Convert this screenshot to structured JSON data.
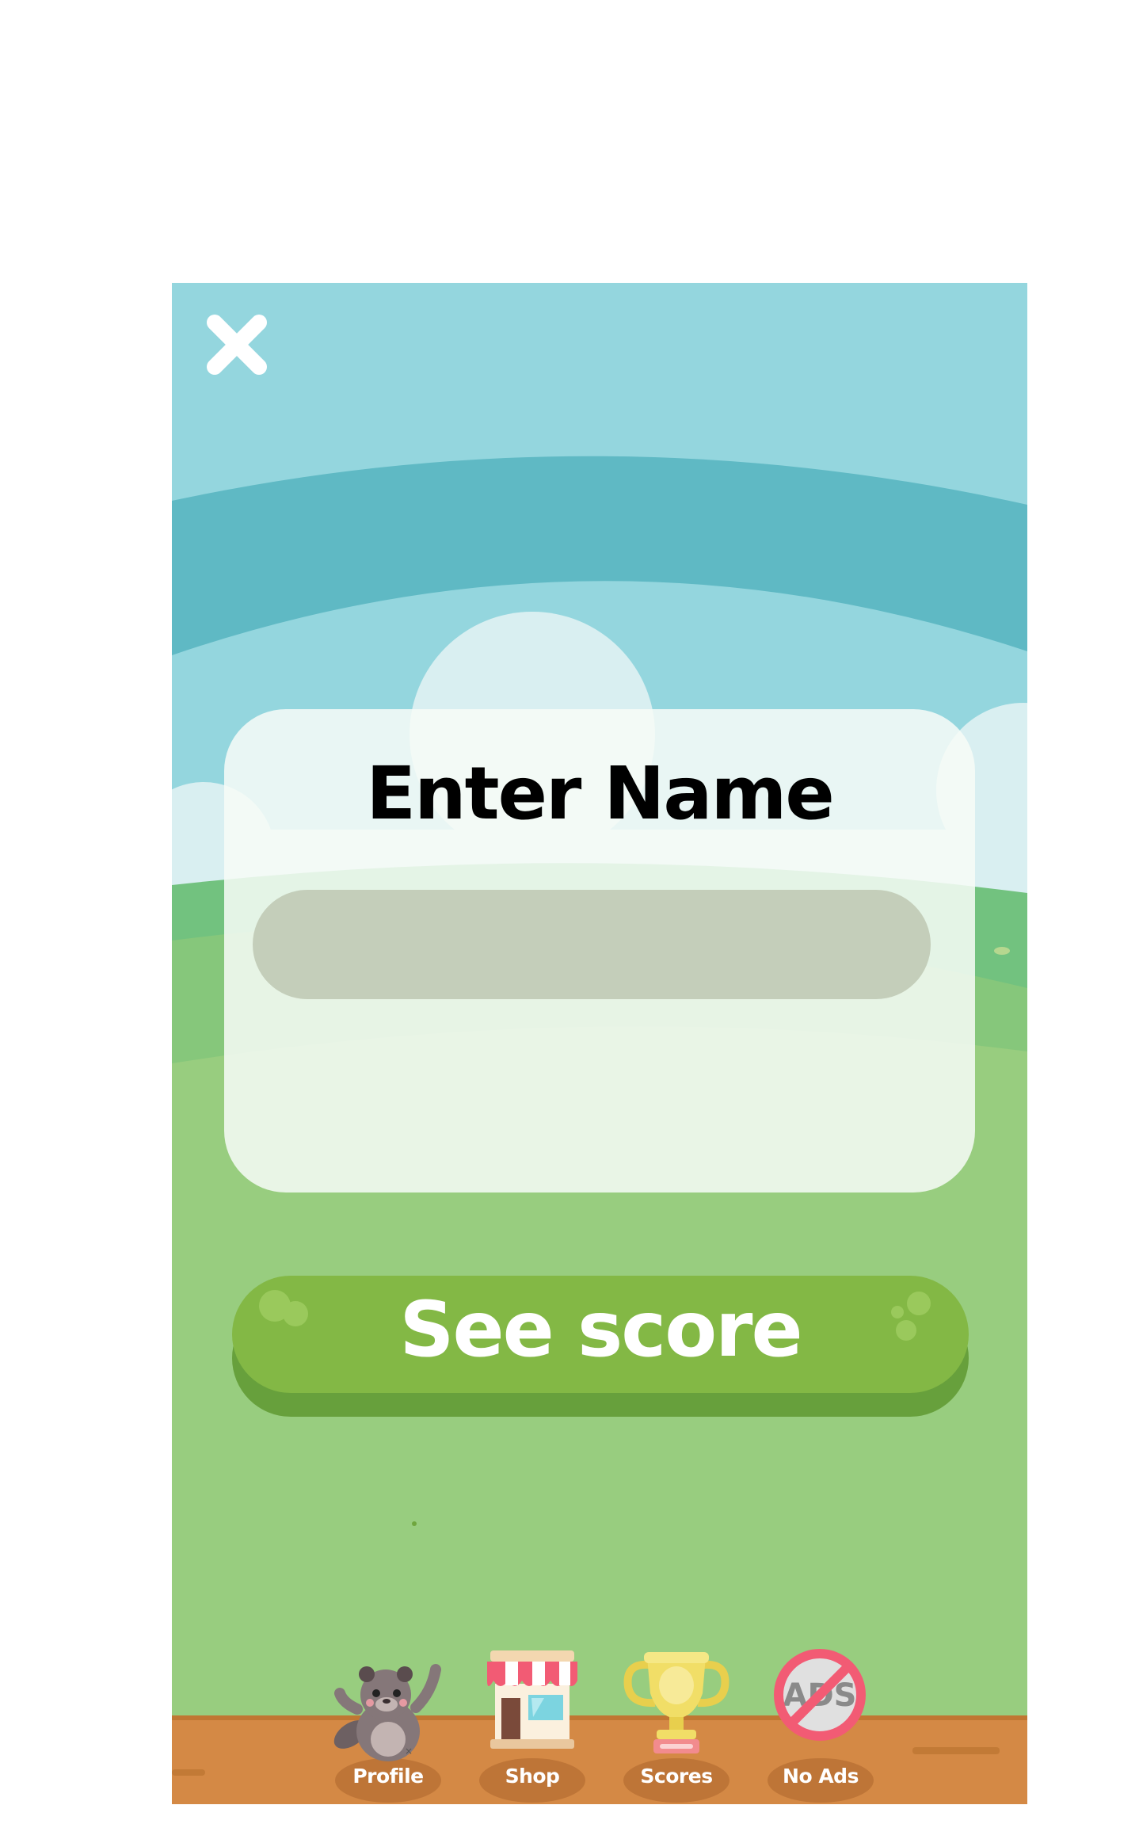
{
  "colors": {
    "sky": "#94d6de",
    "sky_band": "#5fb9c4",
    "grass": "#98cd7f",
    "dirt": "#d48945",
    "button_green": "#83b845",
    "input_fill": "#c4ceba"
  },
  "close_button": {
    "icon": "close-icon"
  },
  "name_panel": {
    "title": "Enter Name",
    "input_value": "",
    "input_placeholder": ""
  },
  "see_score_button": {
    "label": "See score"
  },
  "bottom_nav": {
    "items": [
      {
        "label": "Profile",
        "icon": "beaver-icon"
      },
      {
        "label": "Shop",
        "icon": "shop-icon"
      },
      {
        "label": "Scores",
        "icon": "trophy-icon"
      },
      {
        "label": "No Ads",
        "icon": "no-ads-icon"
      }
    ]
  }
}
